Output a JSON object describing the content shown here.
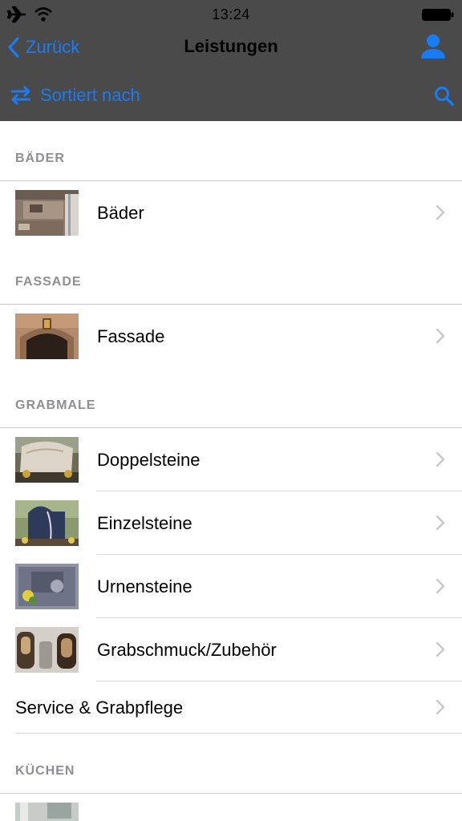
{
  "status": {
    "time": "13:24",
    "icons": [
      "airplane-icon",
      "wifi-icon",
      "battery-icon"
    ]
  },
  "nav": {
    "back_label": "Zurück",
    "title": "Leistungen",
    "user_icon": "user-icon"
  },
  "toolbar": {
    "sort_label": "Sortiert nach",
    "sort_icon": "swap-arrows-icon",
    "search_icon": "search-icon"
  },
  "colors": {
    "accent": "#1a7cf5",
    "header_bg": "#4a4a4a",
    "section_text": "#8e8e93"
  },
  "sections": [
    {
      "title": "BÄDER",
      "items": [
        {
          "label": "Bäder",
          "thumb": "bath-photo"
        }
      ]
    },
    {
      "title": "FASSADE",
      "items": [
        {
          "label": "Fassade",
          "thumb": "facade-photo"
        }
      ]
    },
    {
      "title": "GRABMALE",
      "items": [
        {
          "label": "Doppelsteine",
          "thumb": "double-stone-photo"
        },
        {
          "label": "Einzelsteine",
          "thumb": "single-stone-photo"
        },
        {
          "label": "Urnensteine",
          "thumb": "urn-stone-photo"
        },
        {
          "label": "Grabschmuck/Zubehör",
          "thumb": "grave-decor-photo"
        },
        {
          "label": "Service & Grabpflege",
          "thumb": ""
        }
      ]
    },
    {
      "title": "KÜCHEN",
      "items": []
    }
  ]
}
